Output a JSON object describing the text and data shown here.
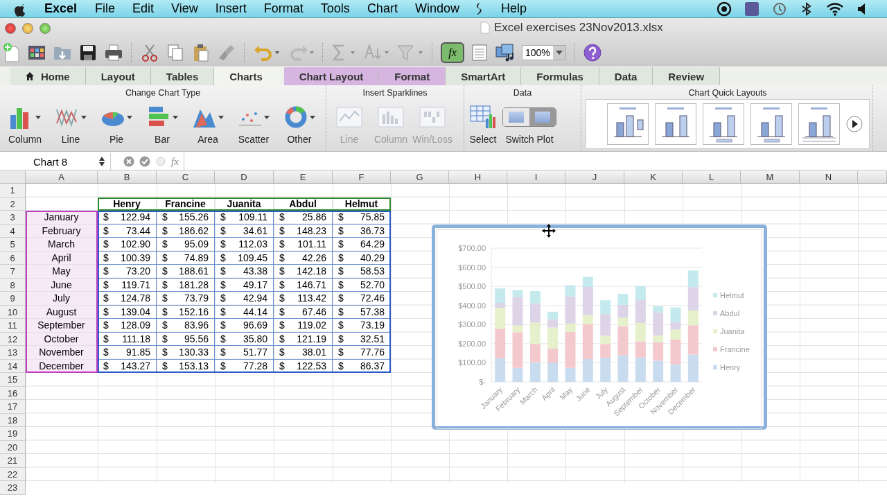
{
  "menu_bar": {
    "app": "Excel",
    "items": [
      "File",
      "Edit",
      "View",
      "Insert",
      "Format",
      "Tools",
      "Chart",
      "Window"
    ],
    "after_script": "Help"
  },
  "window": {
    "title": "Excel exercises 23Nov2013.xlsx"
  },
  "toolbar": {
    "formula_button": "fx",
    "zoom": "100%"
  },
  "ribbon": {
    "tabs": [
      {
        "label": "Home",
        "selected": false,
        "kind": "main"
      },
      {
        "label": "Layout",
        "selected": false,
        "kind": "main"
      },
      {
        "label": "Tables",
        "selected": false,
        "kind": "main"
      },
      {
        "label": "Charts",
        "selected": true,
        "kind": "main"
      },
      {
        "label": "Chart Layout",
        "selected": false,
        "kind": "contextual"
      },
      {
        "label": "Format",
        "selected": false,
        "kind": "contextual"
      },
      {
        "label": "SmartArt",
        "selected": false,
        "kind": "main"
      },
      {
        "label": "Formulas",
        "selected": false,
        "kind": "main"
      },
      {
        "label": "Data",
        "selected": false,
        "kind": "main"
      },
      {
        "label": "Review",
        "selected": false,
        "kind": "main"
      }
    ],
    "groups": [
      {
        "title": "Change Chart Type",
        "items": [
          {
            "label": "Column",
            "disabled": false
          },
          {
            "label": "Line",
            "disabled": false
          },
          {
            "label": "Pie",
            "disabled": false
          },
          {
            "label": "Bar",
            "disabled": false
          },
          {
            "label": "Area",
            "disabled": false
          },
          {
            "label": "Scatter",
            "disabled": false
          },
          {
            "label": "Other",
            "disabled": false
          }
        ]
      },
      {
        "title": "Insert Sparklines",
        "items": [
          {
            "label": "Line",
            "disabled": true
          },
          {
            "label": "Column",
            "disabled": true
          },
          {
            "label": "Win/Loss",
            "disabled": true
          }
        ]
      },
      {
        "title": "Data",
        "items": [
          {
            "label": "Select",
            "disabled": false
          },
          {
            "label": "Switch Plot",
            "disabled": false
          }
        ]
      }
    ],
    "quick_layouts": {
      "title": "Chart Quick Layouts"
    }
  },
  "formula_bar": {
    "name_box": "Chart 8",
    "fx": "fx"
  },
  "sheet": {
    "columns": [
      "A",
      "B",
      "C",
      "D",
      "E",
      "F",
      "G",
      "H",
      "I",
      "J",
      "K",
      "L",
      "M",
      "N"
    ],
    "rows": [
      "1",
      "2",
      "3",
      "4",
      "5",
      "6",
      "7",
      "8",
      "9",
      "10",
      "11",
      "12",
      "13",
      "14",
      "15",
      "16",
      "17",
      "18",
      "19",
      "20",
      "21",
      "22",
      "23"
    ],
    "table": {
      "headers": [
        "Henry",
        "Francine",
        "Juanita",
        "Abdul",
        "Helmut"
      ],
      "rows": [
        {
          "label": "January",
          "values": [
            "122.94",
            "155.26",
            "109.11",
            "25.86",
            "75.85"
          ]
        },
        {
          "label": "February",
          "values": [
            "73.44",
            "186.62",
            "34.61",
            "148.23",
            "36.73"
          ]
        },
        {
          "label": "March",
          "values": [
            "102.90",
            "95.09",
            "112.03",
            "101.11",
            "64.29"
          ]
        },
        {
          "label": "April",
          "values": [
            "100.39",
            "74.89",
            "109.45",
            "42.26",
            "40.29"
          ]
        },
        {
          "label": "May",
          "values": [
            "73.20",
            "188.61",
            "43.38",
            "142.18",
            "58.53"
          ]
        },
        {
          "label": "June",
          "values": [
            "119.71",
            "181.28",
            "49.17",
            "146.71",
            "52.70"
          ]
        },
        {
          "label": "July",
          "values": [
            "124.78",
            "73.79",
            "42.94",
            "113.42",
            "72.46"
          ]
        },
        {
          "label": "August",
          "values": [
            "139.04",
            "152.16",
            "44.14",
            "67.46",
            "57.38"
          ]
        },
        {
          "label": "September",
          "values": [
            "128.09",
            "83.96",
            "96.69",
            "119.02",
            "73.19"
          ]
        },
        {
          "label": "October",
          "values": [
            "111.18",
            "95.56",
            "35.80",
            "121.19",
            "32.51"
          ]
        },
        {
          "label": "November",
          "values": [
            "91.85",
            "130.33",
            "51.77",
            "38.01",
            "77.76"
          ]
        },
        {
          "label": "December",
          "values": [
            "143.27",
            "153.13",
            "77.28",
            "122.53",
            "86.37"
          ]
        }
      ],
      "currency": "$"
    },
    "chart": {
      "chart_data": {
        "type": "bar",
        "stacked": true,
        "orientation": "vertical",
        "grid": true,
        "legend": true,
        "categories": [
          "January",
          "February",
          "March",
          "April",
          "May",
          "June",
          "July",
          "August",
          "September",
          "October",
          "November",
          "December"
        ],
        "series": [
          {
            "name": "Henry",
            "color": "#c9dcef",
            "values": [
              122.94,
              73.44,
              102.9,
              100.39,
              73.2,
              119.71,
              124.78,
              139.04,
              128.09,
              111.18,
              91.85,
              143.27
            ]
          },
          {
            "name": "Francine",
            "color": "#f4c9cd",
            "values": [
              155.26,
              186.62,
              95.09,
              74.89,
              188.61,
              181.28,
              73.79,
              152.16,
              83.96,
              95.56,
              130.33,
              153.13
            ]
          },
          {
            "name": "Juanita",
            "color": "#e6f1cc",
            "values": [
              109.11,
              34.61,
              112.03,
              109.45,
              43.38,
              49.17,
              42.94,
              44.14,
              96.69,
              35.8,
              51.77,
              77.28
            ]
          },
          {
            "name": "Abdul",
            "color": "#ddd4e7",
            "values": [
              25.86,
              148.23,
              101.11,
              42.26,
              142.18,
              146.71,
              113.42,
              67.46,
              119.02,
              121.19,
              38.01,
              122.53
            ]
          },
          {
            "name": "Helmut",
            "color": "#c5eaee",
            "values": [
              75.85,
              36.73,
              64.29,
              40.29,
              58.53,
              52.7,
              72.46,
              57.38,
              73.19,
              32.51,
              77.76,
              86.37
            ]
          }
        ],
        "ylim": [
          0,
          700
        ],
        "yticks": [
          {
            "value": 0,
            "label": "$-"
          },
          {
            "value": 100,
            "label": "$100.00"
          },
          {
            "value": 200,
            "label": "$200.00"
          },
          {
            "value": 300,
            "label": "$300.00"
          },
          {
            "value": 400,
            "label": "$400.00"
          },
          {
            "value": 500,
            "label": "$500.00"
          },
          {
            "value": 600,
            "label": "$600.00"
          },
          {
            "value": 700,
            "label": "$700.00"
          }
        ]
      }
    }
  }
}
